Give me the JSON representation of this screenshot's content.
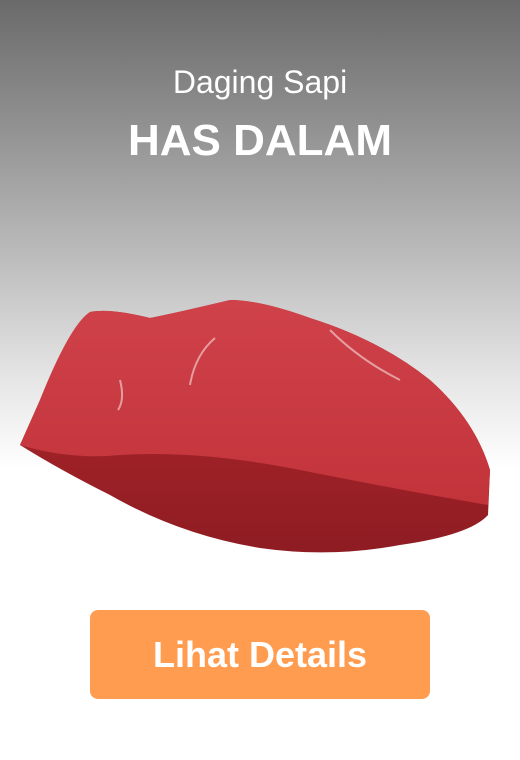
{
  "product": {
    "category": "Daging Sapi",
    "name": "HAS DALAM",
    "details_button_label": "Lihat Details"
  },
  "colors": {
    "button": "#ff9c50",
    "meat": "#c8353a"
  }
}
